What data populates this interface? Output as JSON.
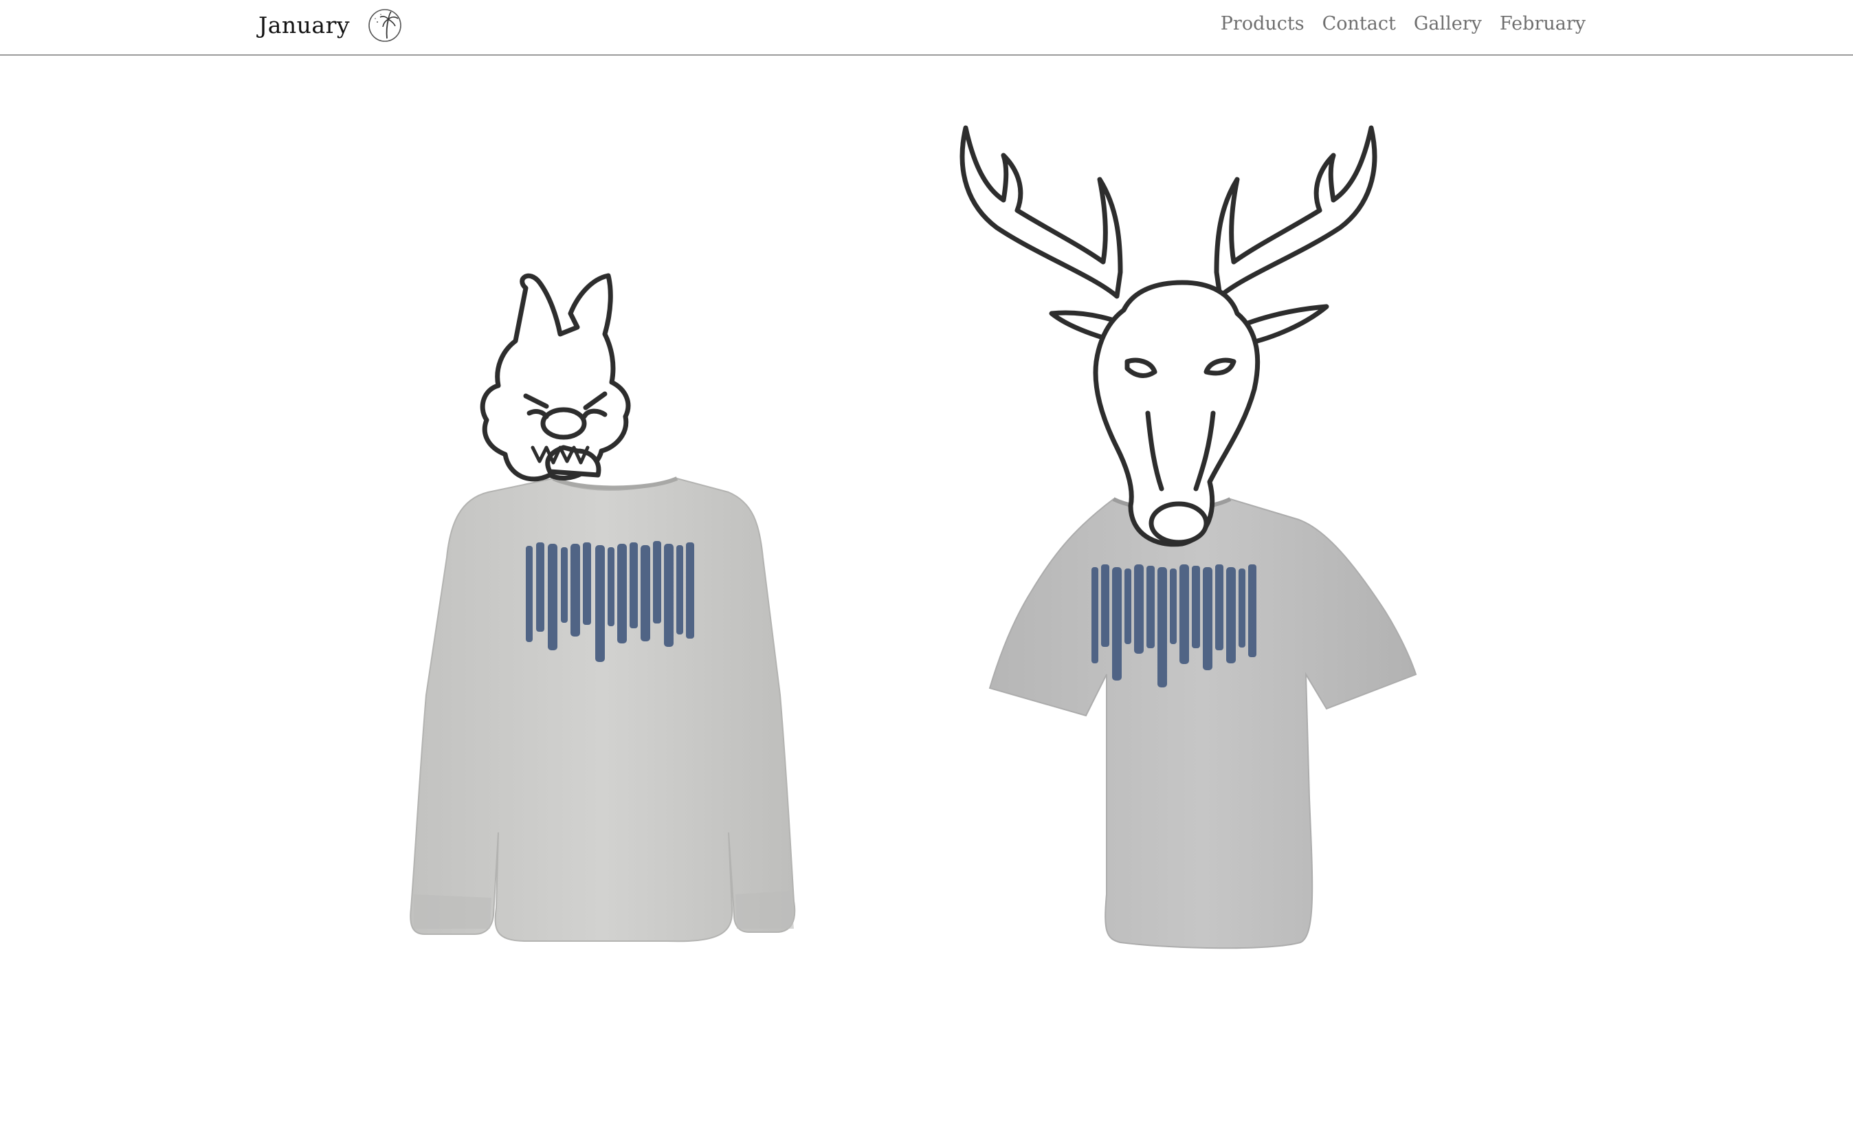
{
  "header": {
    "brand_name": "January",
    "brand_logo_icon": "palm-moon-icon",
    "nav": [
      {
        "label": "Products"
      },
      {
        "label": "Contact"
      },
      {
        "label": "Gallery"
      },
      {
        "label": "February"
      }
    ]
  },
  "gallery": {
    "products": [
      {
        "image": "wolf-longsleeve-shirt-image",
        "shirt_color": "#c9c9c7",
        "print_color": "#4a5f82"
      },
      {
        "image": "deer-tshirt-image",
        "shirt_color": "#bdbdbd",
        "print_color": "#4a5f82"
      }
    ]
  },
  "colors": {
    "background": "#ffffff",
    "nav_text": "#6f6f6f",
    "brand_text": "#111111",
    "divider": "#9a9a9a",
    "ink": "#2d2d2d"
  }
}
